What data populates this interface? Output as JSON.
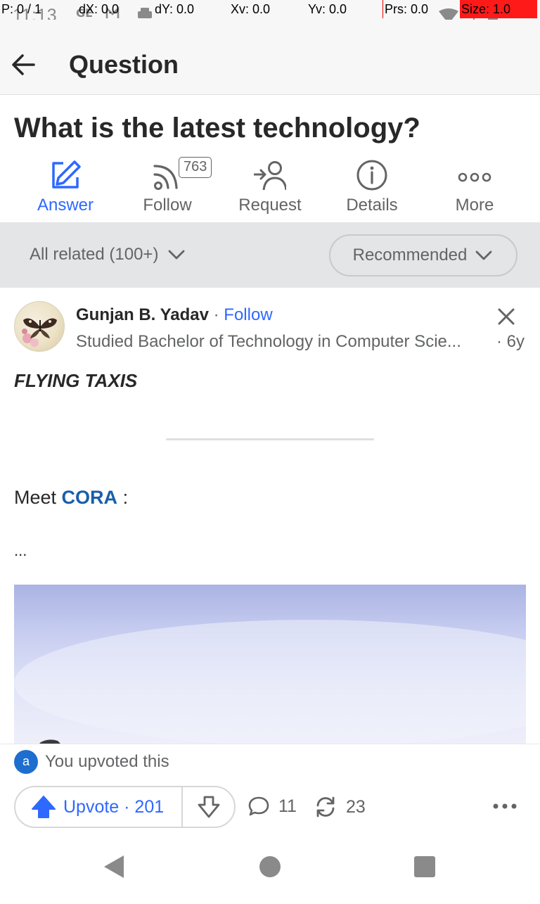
{
  "status_bar": {
    "time": "11:13",
    "debug": {
      "p": "P: 0 / 1",
      "dx": "dX: 0.0",
      "dy": "dY: 0.0",
      "xv": "Xv: 0.0",
      "yv": "Yv: 0.0",
      "prs": "Prs: 0.0",
      "size": "Size: 1.0"
    }
  },
  "header": {
    "title": "Question"
  },
  "question": {
    "title": "What is the latest technology?",
    "actions": [
      {
        "label": "Answer",
        "icon": "edit-icon"
      },
      {
        "label": "Follow",
        "icon": "rss-icon"
      },
      {
        "label": "Request",
        "icon": "request-user-icon"
      },
      {
        "label": "Details",
        "icon": "info-icon"
      },
      {
        "label": "More",
        "icon": "more-icon"
      }
    ],
    "follow_count": "763"
  },
  "filters": {
    "related": "All related (100+)",
    "sort": "Recommended"
  },
  "answer": {
    "author": "Gunjan B. Yadav",
    "separator": "·",
    "follow": "Follow",
    "credential": "Studied Bachelor of Technology in Computer Scie...",
    "age": "· 6y",
    "heading": "FLYING TAXIS",
    "meet_prefix": "Meet",
    "meet_link": "CORA",
    "meet_suffix": ":",
    "ellipsis": "..."
  },
  "footer": {
    "upvoted_badge": "a",
    "upvoted_text": "You upvoted this",
    "upvote_label": "Upvote · 201",
    "comments": "11",
    "shares": "23"
  },
  "colors": {
    "accent": "#2e69ff",
    "link": "#195faa",
    "text": "#282829",
    "muted": "#636466"
  }
}
